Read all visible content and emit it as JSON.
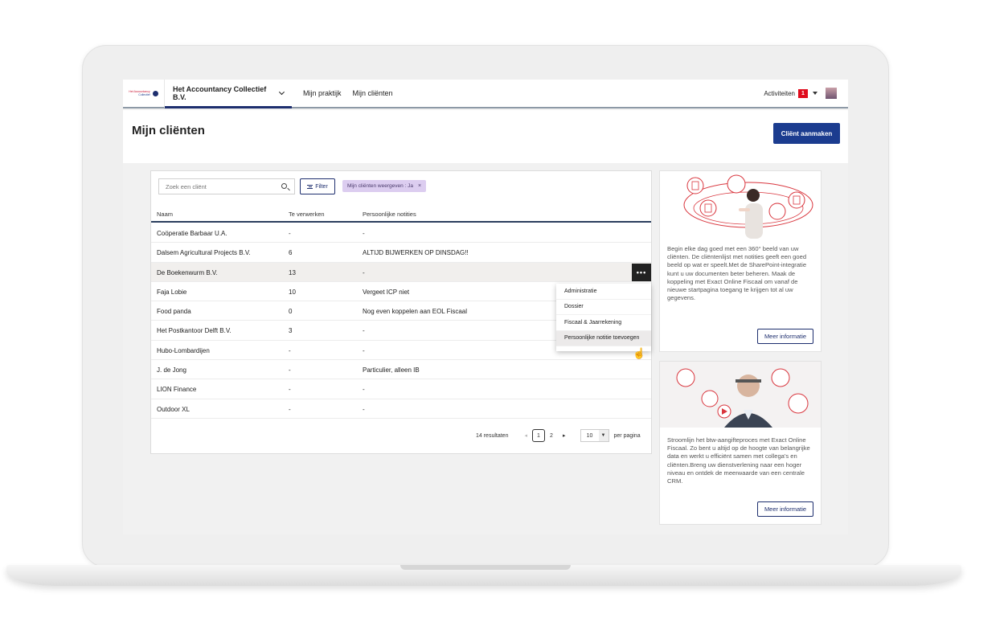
{
  "topbar": {
    "logo_line1": "Het Accountancy",
    "logo_line2": "Collectief",
    "org_name": "Het Accountancy Collectief B.V.",
    "nav": [
      "Mijn praktijk",
      "Mijn cliënten"
    ],
    "activities_label": "Activiteiten",
    "activities_count": "1"
  },
  "page": {
    "title_prefix": "Mijn ",
    "title_strong": "cliënten",
    "create_button": "Cliënt aanmaken"
  },
  "toolbar": {
    "search_placeholder": "Zoek een cliënt",
    "filter_label": "Filter",
    "chip_label": "Mijn cliënten weergeven : Ja",
    "chip_close": "×"
  },
  "table": {
    "headers": {
      "name": "Naam",
      "todo": "Te verwerken",
      "note": "Persoonlijke notities"
    },
    "rows": [
      {
        "name": "Coöperatie Barbaar U.A.",
        "todo": "-",
        "note": "-"
      },
      {
        "name": "Dalsem Agricultural Projects B.V.",
        "todo": "6",
        "note": "ALTIJD BIJWERKEN OP DINSDAG!!"
      },
      {
        "name": "De Boekenwurm B.V.",
        "todo": "13",
        "note": "-"
      },
      {
        "name": "Faja Lobie",
        "todo": "10",
        "note": "Vergeet ICP niet"
      },
      {
        "name": "Food panda",
        "todo": "0",
        "note": "Nog even koppelen aan EOL Fiscaal"
      },
      {
        "name": "Het Postkantoor Delft B.V.",
        "todo": "3",
        "note": "-"
      },
      {
        "name": "Hubo-Lombardijen",
        "todo": "-",
        "note": "-"
      },
      {
        "name": "J. de Jong",
        "todo": "-",
        "note": "Particulier, alleen IB"
      },
      {
        "name": "LION Finance",
        "todo": "-",
        "note": "-"
      },
      {
        "name": "Outdoor XL",
        "todo": "-",
        "note": "-"
      }
    ],
    "row_menu_button": "•••"
  },
  "context_menu": {
    "items": [
      "Administratie",
      "Dossier",
      "Fiscaal & Jaarrekening",
      "Persoonlijke notitie toevoegen"
    ]
  },
  "pagination": {
    "results": "14 resultaten",
    "prev": "◂",
    "next": "▸",
    "page_1": "1",
    "page_2": "2",
    "per_page_value": "10",
    "per_page_label": "per pagina"
  },
  "promo1": {
    "text": "Begin elke dag goed met een 360° beeld van uw cliënten. De cliëntenlijst met notities geeft een goed beeld op wat er speelt.Met de SharePoint-integratie kunt u uw documenten beter beheren. Maak de koppeling met Exact Online Fiscaal om vanaf de nieuwe startpagina toegang te krijgen tot al uw gegevens.",
    "button": "Meer informatie"
  },
  "promo2": {
    "text": "Stroomlijn het btw-aangifteproces met Exact Online Fiscaal. Zo bent u altijd op de hoogte van belangrijke data en werkt u efficiënt samen met collega's en cliënten.Breng uw dienstverlening naar een hoger niveau en ontdek de meerwaarde van een centrale CRM.",
    "button": "Meer informatie"
  },
  "colors": {
    "brand_navy": "#1b3c8f",
    "badge_red": "#e00b1c",
    "chip_purple": "#dccdf0",
    "illustration_red": "#d9363e"
  }
}
